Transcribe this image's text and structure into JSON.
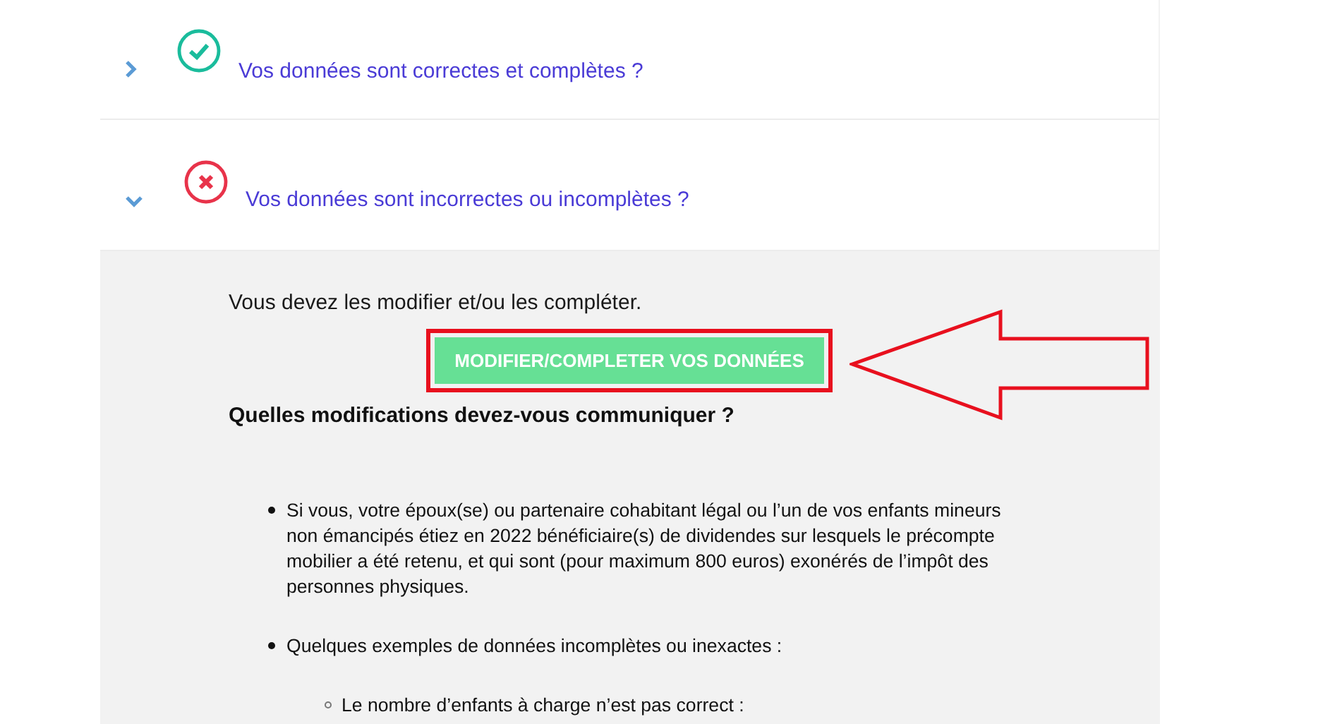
{
  "sections": [
    {
      "title": "Vos données sont correctes et complètes ?",
      "kind": "ok",
      "expanded": false
    },
    {
      "title": "Vos données sont incorrectes ou incomplètes ?",
      "kind": "error",
      "expanded": true
    }
  ],
  "panel": {
    "intro": "Vous devez les modifier et/ou les compléter.",
    "button": {
      "label": "MODIFIER/COMPLETER VOS DONNÉES",
      "highlighted": true
    },
    "heading": "Quelles modifications devez-vous communiquer ?",
    "bullets": [
      {
        "text": "Si vous, votre époux(se) ou partenaire cohabitant légal ou l’un de vos enfants mineurs non émancipés étiez en 2022 bénéficiaire(s) de dividendes sur lesquels le précompte mobilier a été retenu, et qui sont (pour maximum 800 euros) exonérés de l’impôt des personnes physiques."
      },
      {
        "text": "Quelques exemples de données incomplètes ou inexactes :",
        "children": [
          {
            "text": "Le nombre d’enfants à charge n’est pas correct :"
          }
        ]
      }
    ]
  }
}
